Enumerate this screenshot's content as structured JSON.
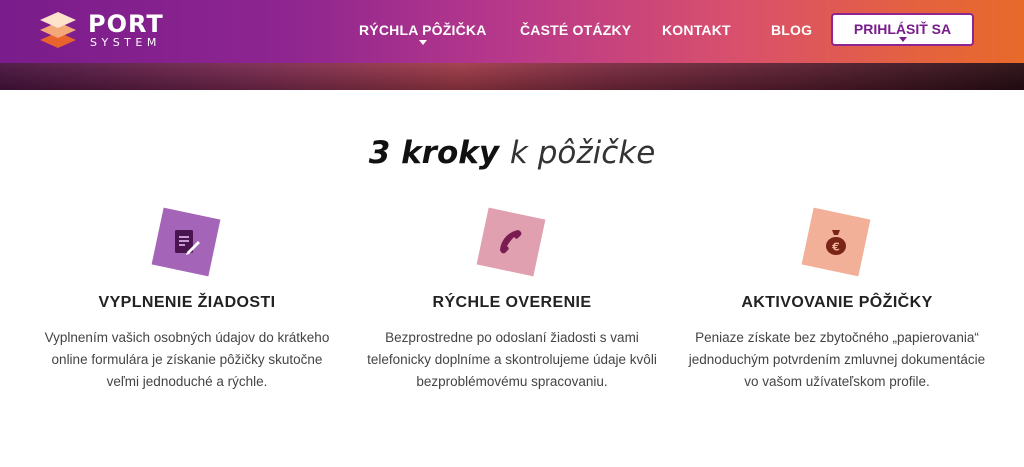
{
  "brand": {
    "name": "PORT",
    "tagline": "SYSTEM",
    "colors": {
      "primary": "#7a1c8c",
      "gradient_end": "#e86a2a",
      "tile_purple": "#a464b8",
      "tile_pink": "#e0a0b0",
      "tile_orange": "#f2b098"
    }
  },
  "nav": {
    "items": [
      {
        "label": "RÝCHLA PÔŽIČKA",
        "has_dropdown": true
      },
      {
        "label": "ČASTÉ OTÁZKY",
        "has_dropdown": false
      },
      {
        "label": "KONTAKT",
        "has_dropdown": false
      },
      {
        "label": "BLOG",
        "has_dropdown": false
      }
    ],
    "login_label": "PRIHLÁSIŤ SA"
  },
  "section": {
    "title_strong": "3 kroky",
    "title_light": "k pôžičke"
  },
  "steps": [
    {
      "icon": "document-sign-icon",
      "title": "VYPLNENIE ŽIADOSTI",
      "text": "Vyplnením vašich osobných údajov do krátkeho online formulára je získanie pôžičky skutočne veľmi jednoduché a rýchle."
    },
    {
      "icon": "phone-icon",
      "title": "RÝCHLE OVERENIE",
      "text": "Bezprostredne po odoslaní žiadosti s vami telefonicky doplníme a skontrolujeme údaje kvôli bezproblémovému spracovaniu."
    },
    {
      "icon": "money-bag-euro-icon",
      "title": "AKTIVOVANIE PÔŽIČKY",
      "text": "Peniaze získate bez zbytočného „papierovania“ jednoduchým potvrdením zmluvnej dokumentácie vo vašom užívateľskom profile."
    }
  ]
}
